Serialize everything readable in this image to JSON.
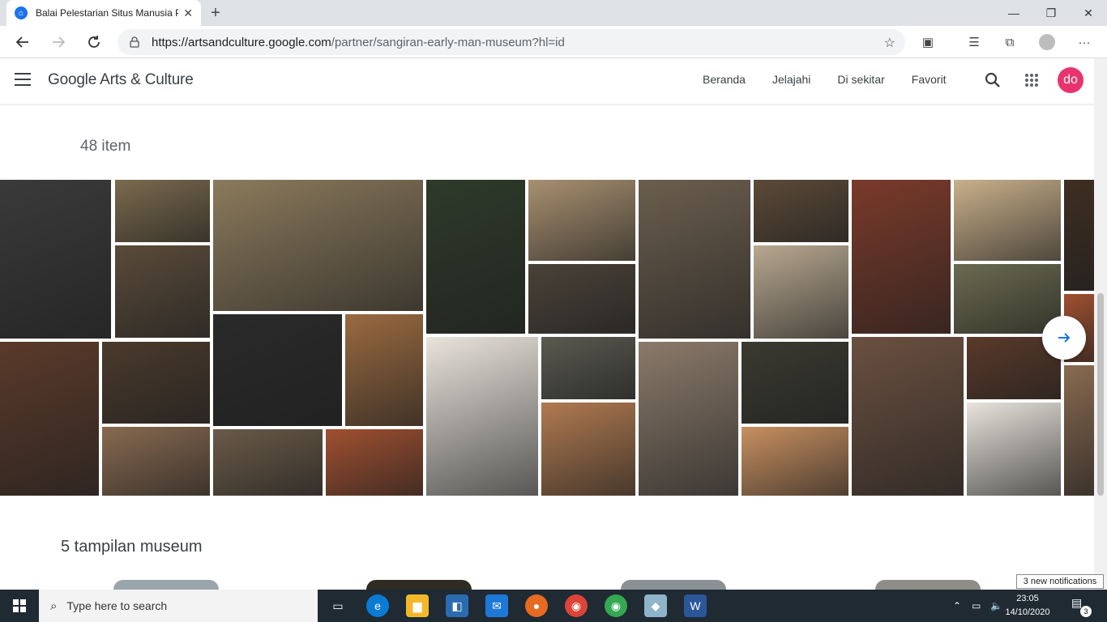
{
  "browser": {
    "tab_title": "Balai Pelestarian Situs Manusia P",
    "url_host": "https://artsandculture.google.com",
    "url_path": "/partner/sangiran-early-man-museum?hl=id",
    "new_tab": "+",
    "tab_close": "✕",
    "window_buttons": [
      "—",
      "❐",
      "✕"
    ]
  },
  "site": {
    "logo": "Google Arts & Culture",
    "nav": [
      "Beranda",
      "Jelajahi",
      "Di sekitar",
      "Favorit"
    ],
    "avatar": "do"
  },
  "content": {
    "item_count": "48 item",
    "section_title": "5 tampilan museum"
  },
  "gallery_colors": [
    "#3a3a3a",
    "#7b6a4e",
    "#5a4b3a",
    "#8b7a5c",
    "#2e3a2a",
    "#a89070",
    "#4a4238",
    "#6b5e4e",
    "#5c4a38",
    "#b8a890",
    "#7a3a2a",
    "#c9b08a",
    "#6b6b50",
    "#3e2e22",
    "#5a3a2a",
    "#4a3a2c",
    "#886a50",
    "#2a2a2a",
    "#9a6a40",
    "#6a5a48",
    "#a05030",
    "#e8e4dc",
    "#5a5a50",
    "#b07a50",
    "#8a7a6a",
    "#3a3a30",
    "#c89060",
    "#6a5040"
  ],
  "taskbar": {
    "search_placeholder": "Type here to search",
    "time": "23:05",
    "date": "14/10/2020",
    "notifications_popup": "3 new notifications",
    "notification_count": "3"
  }
}
